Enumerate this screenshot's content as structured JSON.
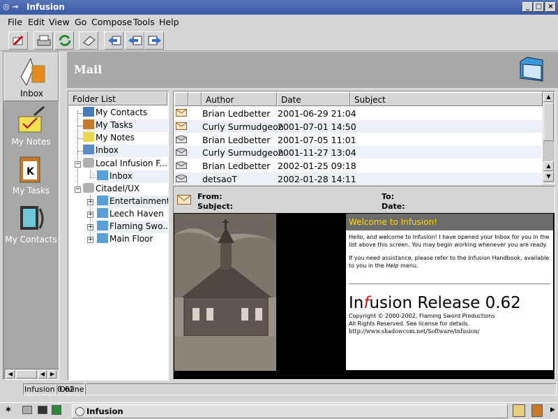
{
  "window": {
    "title": "Infusion"
  },
  "menu": {
    "file": "File",
    "edit": "Edit",
    "view": "View",
    "go": "Go",
    "compose": "Compose",
    "tools": "Tools",
    "help": "Help"
  },
  "shortcuts": {
    "inbox": "Inbox",
    "notes": "My Notes",
    "tasks": "My Tasks",
    "contacts": "My Contacts"
  },
  "header": {
    "title": "Mail"
  },
  "folders": {
    "heading": "Folder List",
    "items": [
      "My Contacts",
      "My Tasks",
      "My Notes",
      "Inbox",
      "Local Infusion F...",
      "Inbox",
      "Citadel/UX",
      "Entertainment",
      "Leech Haven",
      "Flaming Swo...",
      "Main Floor"
    ]
  },
  "messages": {
    "columns": {
      "author": "Author",
      "date": "Date",
      "subject": "Subject"
    },
    "rows": [
      {
        "author": "Brian Ledbetter",
        "date": "2001-06-29 21:04"
      },
      {
        "author": "Curly Surmudgeon",
        "date": "2001-07-01 14:50"
      },
      {
        "author": "Brian Ledbetter",
        "date": "2001-07-05 11:01"
      },
      {
        "author": "Curly Surmudgeon",
        "date": "2001-11-27 13:04"
      },
      {
        "author": "Brian Ledbetter",
        "date": "2002-01-25 09:18"
      },
      {
        "author": "detsaoT",
        "date": "2002-01-28 14:11"
      }
    ]
  },
  "preview": {
    "from_label": "From:",
    "subject_label": "Subject:",
    "to_label": "To:",
    "date_label": "Date:",
    "welcome": "Welcome to Infusion!",
    "para1": "Hello, and welcome to Infusion! I have opened your Inbox for you in the list above this screen. You may begin working whenever you are ready.",
    "para2a": "If you need assistance, please refer to the Infusion Handbook, available to you in the ",
    "para2b": "Help",
    "para2c": " menu.",
    "brand_in": "In",
    "brand_f": "f",
    "brand_rest": "usion",
    "release": "Release 0.62",
    "copyright": "Copyright © 2000-2002, Flaming Sword Productions",
    "rights": "All Rights Reserved. See license for details.",
    "url": "http://www.shadowcom.net/Software/infusion/"
  },
  "status": {
    "version": "Infusion 0.62",
    "state": "Online"
  },
  "taskbar": {
    "task": "Infusion"
  }
}
